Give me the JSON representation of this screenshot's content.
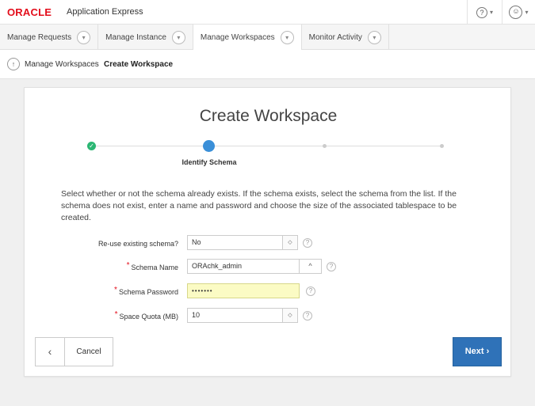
{
  "header": {
    "logo": "ORACLE",
    "product": "Application Express",
    "help_icon": "help-circle-icon",
    "user_icon": "user-circle-icon"
  },
  "tabs": [
    {
      "label": "Manage Requests"
    },
    {
      "label": "Manage Instance"
    },
    {
      "label": "Manage Workspaces",
      "active": true
    },
    {
      "label": "Monitor Activity"
    }
  ],
  "breadcrumb": {
    "parent": "Manage Workspaces",
    "current": "Create Workspace"
  },
  "wizard": {
    "title": "Create Workspace",
    "current_step": "Identify Schema",
    "description": "Select whether or not the schema already exists. If the schema exists, select the schema from the list. If the schema does not exist, enter a name and password and choose the size of the associated tablespace to be created."
  },
  "form": {
    "reuse_label": "Re-use existing schema?",
    "reuse_value": "No",
    "schema_name_label": "Schema Name",
    "schema_name_value": "ORAchk_admin",
    "schema_password_label": "Schema Password",
    "schema_password_value": "•••••••",
    "quota_label": "Space Quota (MB)",
    "quota_value": "10"
  },
  "buttons": {
    "previous": "‹",
    "cancel": "Cancel",
    "next": "Next ›"
  },
  "colors": {
    "accent": "#2f72b8",
    "step_done": "#2bb673",
    "step_current": "#3a8fd8",
    "required": "#e30d1b"
  }
}
